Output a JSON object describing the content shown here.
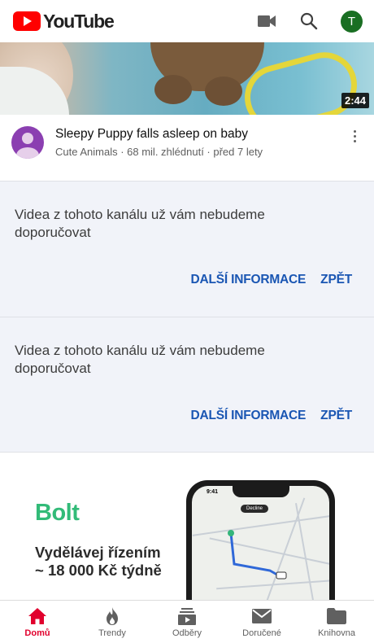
{
  "header": {
    "logo_text": "YouTube",
    "icons": [
      "camera-icon",
      "search-icon"
    ],
    "account_initial": "T",
    "colors": {
      "brand": "#ff0000",
      "avatar": "#1a6f23"
    }
  },
  "video": {
    "duration": "2:44",
    "title": "Sleepy Puppy falls asleep on baby",
    "subtitle": "Cute Animals · 68 mil. zhlédnutí · před 7 lety"
  },
  "notices": [
    {
      "text": "Videa z tohoto kanálu už vám nebudeme doporučovat",
      "more_label": "DALŠÍ INFORMACE",
      "undo_label": "ZPĚT"
    },
    {
      "text": "Videa z tohoto kanálu už vám nebudeme doporučovat",
      "more_label": "DALŠÍ INFORMACE",
      "undo_label": "ZPĚT"
    }
  ],
  "ad": {
    "brand": "Bolt",
    "headline_line1": "Vydělávej řízením",
    "headline_line2": "~ 18 000 Kč týdně",
    "phone_time": "9:41",
    "phone_pill": "Decline",
    "colors": {
      "brand": "#32bb78"
    }
  },
  "bottom_nav": [
    {
      "label": "Domů",
      "icon": "home-icon",
      "active": true
    },
    {
      "label": "Trendy",
      "icon": "flame-icon",
      "active": false
    },
    {
      "label": "Odběry",
      "icon": "subscriptions-icon",
      "active": false
    },
    {
      "label": "Doručené",
      "icon": "inbox-icon",
      "active": false
    },
    {
      "label": "Knihovna",
      "icon": "library-icon",
      "active": false
    }
  ]
}
